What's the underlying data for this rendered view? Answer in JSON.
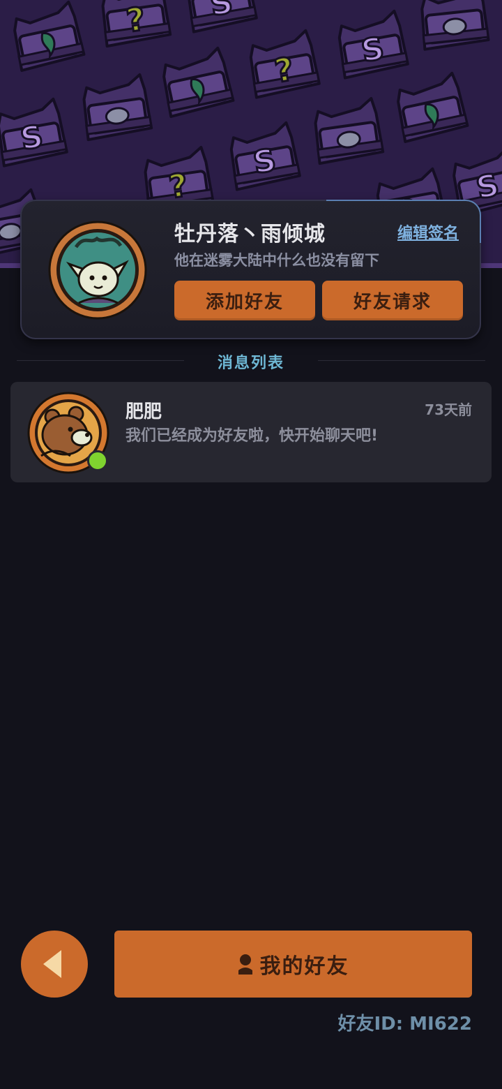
{
  "profile": {
    "username": "牡丹落丶雨倾城",
    "signature": "他在迷雾大陆中什么也没有留下",
    "edit_signature_label": "编辑签名",
    "add_friend_label": "添加好友",
    "friend_request_label": "好友请求"
  },
  "messages": {
    "section_title": "消息列表",
    "items": [
      {
        "name": "肥肥",
        "time": "73天前",
        "preview": "我们已经成为好友啦，快开始聊天吧!",
        "online": true
      }
    ]
  },
  "footer": {
    "my_friends_label": "我的好友",
    "friend_id": "好友ID: MI622"
  },
  "colors": {
    "accent": "#cb6a2b",
    "background": "#12121b",
    "banner": "#2b1d47",
    "card": "#23232e",
    "online": "#7fd32f",
    "link": "#7fb2e0",
    "section_title": "#6eb7d4"
  },
  "icons": [
    "mystery-box-pattern",
    "cat-avatar",
    "bear-avatar",
    "online-status-icon",
    "back-arrow-icon",
    "person-icon"
  ]
}
